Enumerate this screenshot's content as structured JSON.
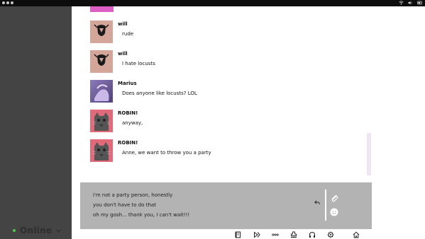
{
  "window": {
    "dots": [
      "dot",
      "dot",
      "dot"
    ],
    "tray": {
      "wifi": "wifi-icon",
      "volume": "volume-icon",
      "time_icon": "clock-icon"
    }
  },
  "sidebar": {
    "status_label": "Online",
    "status_color": "#4ec94e"
  },
  "messages": [
    {
      "author": "will",
      "text": "rude",
      "avatar": "mask-avatar"
    },
    {
      "author": "will",
      "text": "I hate locusts",
      "avatar": "mask-avatar"
    },
    {
      "author": "Marius",
      "text": "Does anyone like locusts? LOL",
      "avatar": "purple-avatar"
    },
    {
      "author": "ROBIN!",
      "text": "anyway,",
      "avatar": "cat-avatar"
    },
    {
      "author": "ROBIN!",
      "text": "Anne, we want to throw you a party",
      "avatar": "cat-avatar"
    }
  ],
  "composer": {
    "lines": [
      "i'm not a party person, honestly",
      "you don't have to do that",
      "oh my gosh... thank you, I can't wait!!!"
    ]
  },
  "toolbar": {
    "icons": [
      "book-icon",
      "skip-icon",
      "more-icon",
      "stamp-icon",
      "headphones-icon",
      "gear-icon",
      "home-icon"
    ]
  },
  "colors": {
    "sidebar_bg": "#444444",
    "accent_pink": "#dd5fc6",
    "composer_bg": "#b3b3b3"
  }
}
